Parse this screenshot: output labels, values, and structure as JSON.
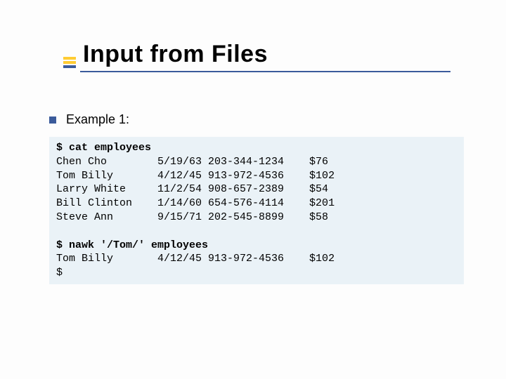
{
  "slide": {
    "title": "Input from Files",
    "bullet1": "Example 1:",
    "cmd1": "$ cat employees",
    "rows": [
      {
        "name": "Chen Cho",
        "date": "5/19/63",
        "phone": "203-344-1234",
        "amount": "$76"
      },
      {
        "name": "Tom Billy",
        "date": "4/12/45",
        "phone": "913-972-4536",
        "amount": "$102"
      },
      {
        "name": "Larry White",
        "date": "11/2/54",
        "phone": "908-657-2389",
        "amount": "$54"
      },
      {
        "name": "Bill Clinton",
        "date": "1/14/60",
        "phone": "654-576-4114",
        "amount": "$201"
      },
      {
        "name": "Steve Ann",
        "date": "9/15/71",
        "phone": "202-545-8899",
        "amount": "$58"
      }
    ],
    "cmd2": "$ nawk '/Tom/' employees",
    "result_rows": [
      {
        "name": "Tom Billy",
        "date": "4/12/45",
        "phone": "913-972-4536",
        "amount": "$102"
      }
    ],
    "prompt_end": "$"
  }
}
